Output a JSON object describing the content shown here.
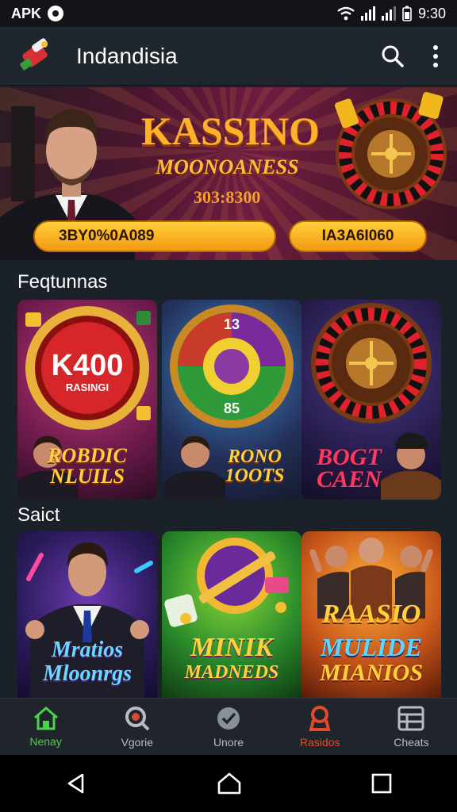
{
  "status_bar": {
    "carrier": "APK",
    "time": "9:30"
  },
  "app_bar": {
    "title": "Indandisia"
  },
  "banner": {
    "headline": "KASSINO",
    "subline": "MOONOANESS",
    "code": "303:8300",
    "left_button": "3BY0%0A089",
    "right_button": "IA3A6I060"
  },
  "sections": {
    "featured": "Feqtunnas",
    "second": "Saict"
  },
  "cards_row1": [
    {
      "chip_value": "K400",
      "chip_sub": "RASINGI",
      "line1": "ROBDIC",
      "line2": "NLUILS"
    },
    {
      "wheel_top": "13",
      "wheel_bottom": "85",
      "line1": "RONO",
      "line2": "1OOTS"
    },
    {
      "line1": "BOGT",
      "line2": "CAEN"
    }
  ],
  "cards_row2": [
    {
      "line1": "Mratios",
      "line2": "Mloonrgs"
    },
    {
      "line1": "MINIK",
      "line2": "MADNEDS"
    },
    {
      "line1": "RAASIO",
      "line2": "MULIDE",
      "line3": "MIANIOS"
    }
  ],
  "bottom_nav": [
    {
      "label": "Nenay",
      "icon": "home-icon"
    },
    {
      "label": "Vgorie",
      "icon": "search-chip-icon"
    },
    {
      "label": "Unore",
      "icon": "badge-check-icon"
    },
    {
      "label": "Rasidos",
      "icon": "trophy-icon"
    },
    {
      "label": "Cheats",
      "icon": "grid-icon"
    }
  ],
  "colors": {
    "accent_gold": "#ffb12a",
    "nav_active": "#4cd14a",
    "nav_hot": "#e44a2a",
    "background": "#1b2129"
  }
}
